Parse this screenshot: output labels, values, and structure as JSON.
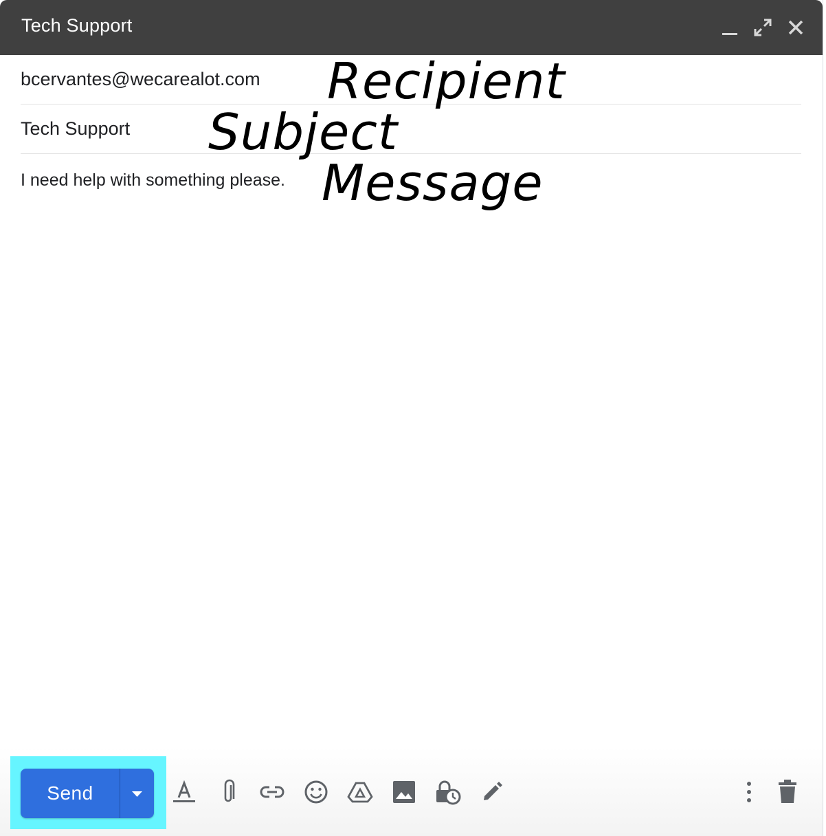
{
  "window": {
    "title": "Tech Support",
    "controls": [
      "minimize-icon",
      "expand-icon",
      "close-icon"
    ]
  },
  "compose": {
    "recipient": "bcervantes@wecarealot.com",
    "subject": "Tech Support",
    "message": "I need help with something please."
  },
  "annotations": {
    "recipient": "Recipient",
    "subject": "Subject",
    "message": "Message"
  },
  "footer": {
    "send_label": "Send",
    "send_more": "chevron-down-icon",
    "tools": [
      "format-text-icon",
      "attach-icon",
      "link-icon",
      "emoji-icon",
      "drive-icon",
      "image-icon",
      "confidential-icon",
      "signature-icon"
    ],
    "more": "more-vert-icon",
    "discard": "trash-icon"
  },
  "colors": {
    "titlebar": "#404040",
    "send_button": "#2f6fde",
    "highlight": "#66f5ff",
    "icon": "#5f6368"
  }
}
